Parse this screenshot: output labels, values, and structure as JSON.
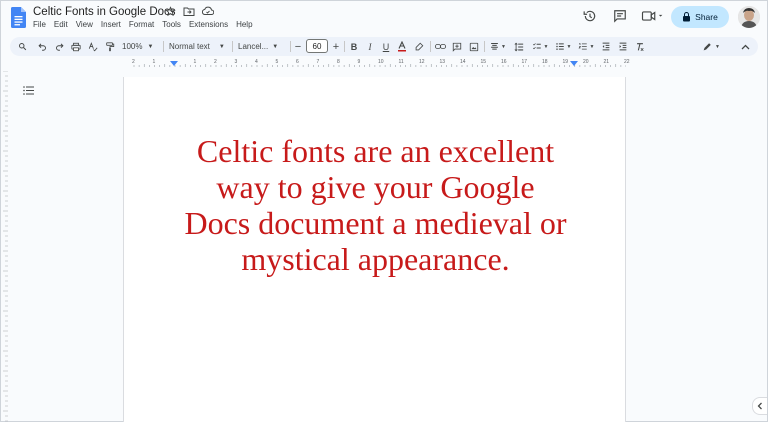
{
  "document": {
    "title": "Celtic Fonts in Google Docs",
    "body_text": "Celtic fonts are an excellent way to give your Google Docs document a medieval or mystical appearance."
  },
  "menu": {
    "items": [
      "File",
      "Edit",
      "View",
      "Insert",
      "Format",
      "Tools",
      "Extensions",
      "Help"
    ]
  },
  "header": {
    "share_label": "Share"
  },
  "toolbar": {
    "zoom": "100%",
    "style": "Normal text",
    "font": "Lancel...",
    "font_size": "60"
  },
  "ruler": {
    "labels": [
      "2",
      "1",
      "1",
      "2",
      "3",
      "4",
      "5",
      "6",
      "7",
      "8",
      "9",
      "10",
      "11",
      "12",
      "13",
      "14",
      "15",
      "16",
      "17",
      "18",
      "19",
      "20",
      "21",
      "22"
    ]
  },
  "colors": {
    "text_color": "#c71a1a",
    "share_bg": "#c2e7ff",
    "toolbar_bg": "#edf2fa"
  }
}
